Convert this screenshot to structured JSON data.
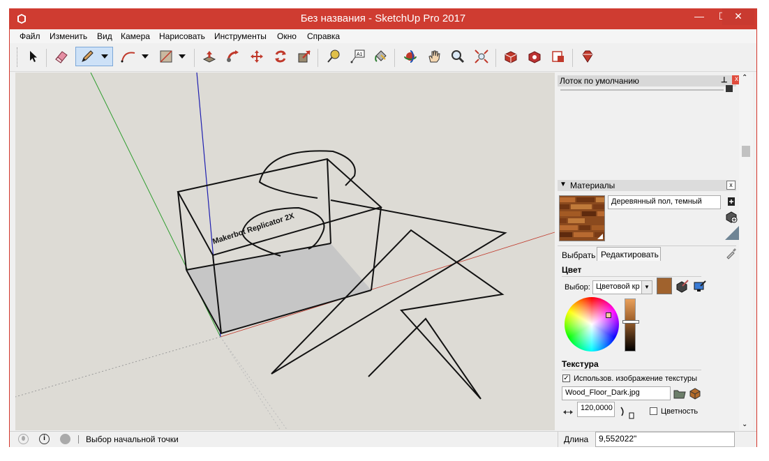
{
  "window": {
    "title": "Без названия - SketchUp Pro 2017",
    "minimize_glyph": "—",
    "maximize_glyph": "☐",
    "close_glyph": "✕"
  },
  "menu": [
    "Файл",
    "Изменить",
    "Вид",
    "Камера",
    "Нарисовать",
    "Инструменты",
    "Окно",
    "Справка"
  ],
  "model": {
    "label_text": "Makerbot Replicator 2X"
  },
  "tray": {
    "title": "Лоток по умолчанию",
    "pin_glyph": "⊥",
    "close_glyph": "x"
  },
  "materials": {
    "header": "Материалы",
    "collapse_glyph": "▼",
    "close_glyph": "x",
    "material_name": "Деревянный пол, темный",
    "tabs": [
      "Выбрать",
      "Редактировать"
    ],
    "color_section": "Цвет",
    "picker_label": "Выбор:",
    "picker_value": "Цветовой кр",
    "swatch_color": "#a0622d",
    "texture_section": "Текстура",
    "use_texture_label": "Использов. изображение текстуры",
    "use_texture_checked": "✓",
    "texture_file": "Wood_Floor_Dark.jpg",
    "width_value": "120,0000",
    "colorize_label": "Цветность"
  },
  "status": {
    "message": "Выбор начальной точки",
    "measure_label": "Длина",
    "measure_value": "9,552022\""
  },
  "colors": {
    "title_bar": "#cf3c31",
    "viewport_bg": "#dddbd5",
    "axis_red": "#c0392b",
    "axis_green": "#2e9d2e",
    "axis_blue": "#1f1fb0"
  }
}
